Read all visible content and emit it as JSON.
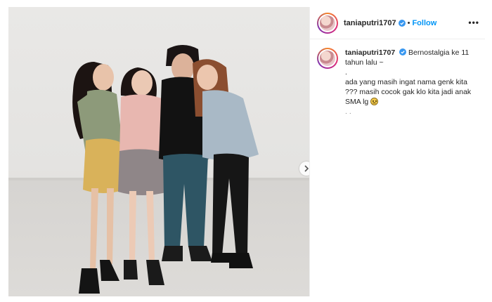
{
  "post": {
    "username": "taniaputri1707",
    "follow_label": "Follow",
    "separator": "•",
    "more_label": "•••"
  },
  "caption": {
    "username": "taniaputri1707",
    "lines": [
      "Bernostalgia ke 11",
      "tahun lalu ~",
      ".",
      "ada yang masih ingat nama genk kita",
      "??? masih cocok gak klo kita jadi anak",
      "SMA lg"
    ],
    "trailing": ". ."
  },
  "icons": {
    "verified": "verified-badge-icon",
    "next": "chevron-right-icon",
    "emoji": "grinning-face-emoji-icon"
  },
  "colors": {
    "follow": "#0095f6",
    "verified": "#3897f0",
    "text": "#262626",
    "border": "#efefef"
  }
}
